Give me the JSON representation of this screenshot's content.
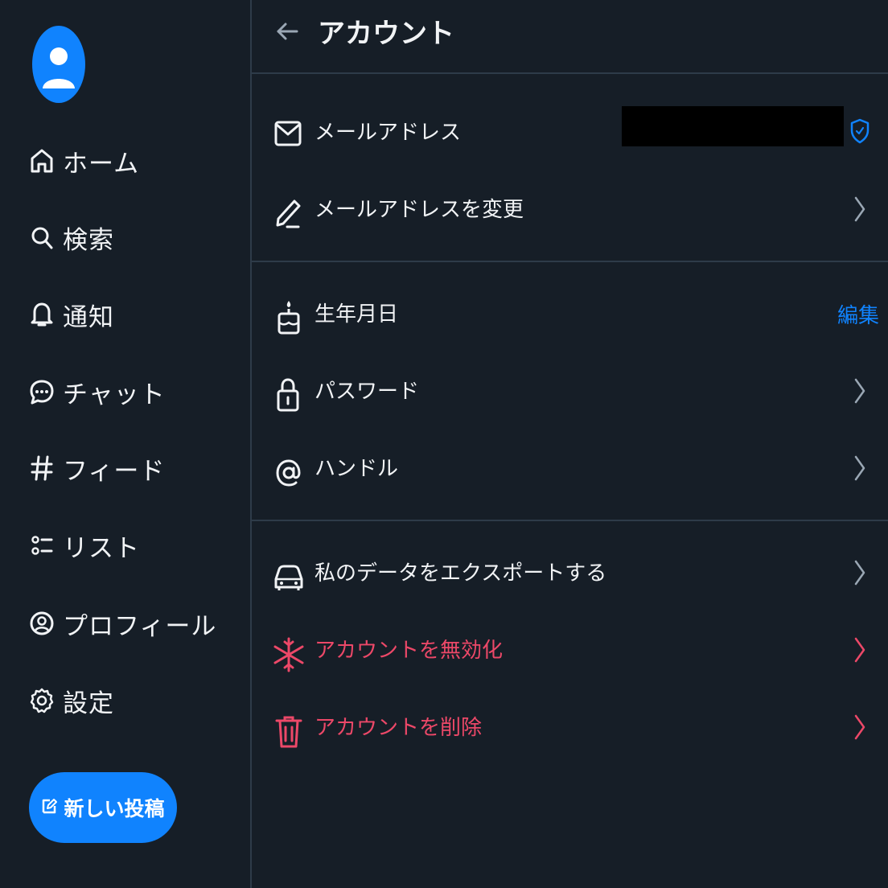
{
  "sidebar": {
    "items": [
      {
        "label": "ホーム",
        "icon": "home-icon"
      },
      {
        "label": "検索",
        "icon": "search-icon"
      },
      {
        "label": "通知",
        "icon": "bell-icon"
      },
      {
        "label": "チャット",
        "icon": "chat-icon"
      },
      {
        "label": "フィード",
        "icon": "hash-icon"
      },
      {
        "label": "リスト",
        "icon": "list-icon"
      },
      {
        "label": "プロフィール",
        "icon": "profile-icon"
      },
      {
        "label": "設定",
        "icon": "gear-icon"
      }
    ],
    "compose_label": "新しい投稿"
  },
  "header": {
    "title": "アカウント"
  },
  "account": {
    "email_label": "メールアドレス",
    "change_email_label": "メールアドレスを変更",
    "birthday_label": "生年月日",
    "birthday_edit": "編集",
    "password_label": "パスワード",
    "handle_label": "ハンドル",
    "export_label": "私のデータをエクスポートする",
    "deactivate_label": "アカウントを無効化",
    "delete_label": "アカウントを削除"
  },
  "colors": {
    "background": "#161e27",
    "accent": "#1083fe",
    "danger": "#ec4868",
    "divider": "#2e3b49",
    "text": "#f1f3f5"
  }
}
